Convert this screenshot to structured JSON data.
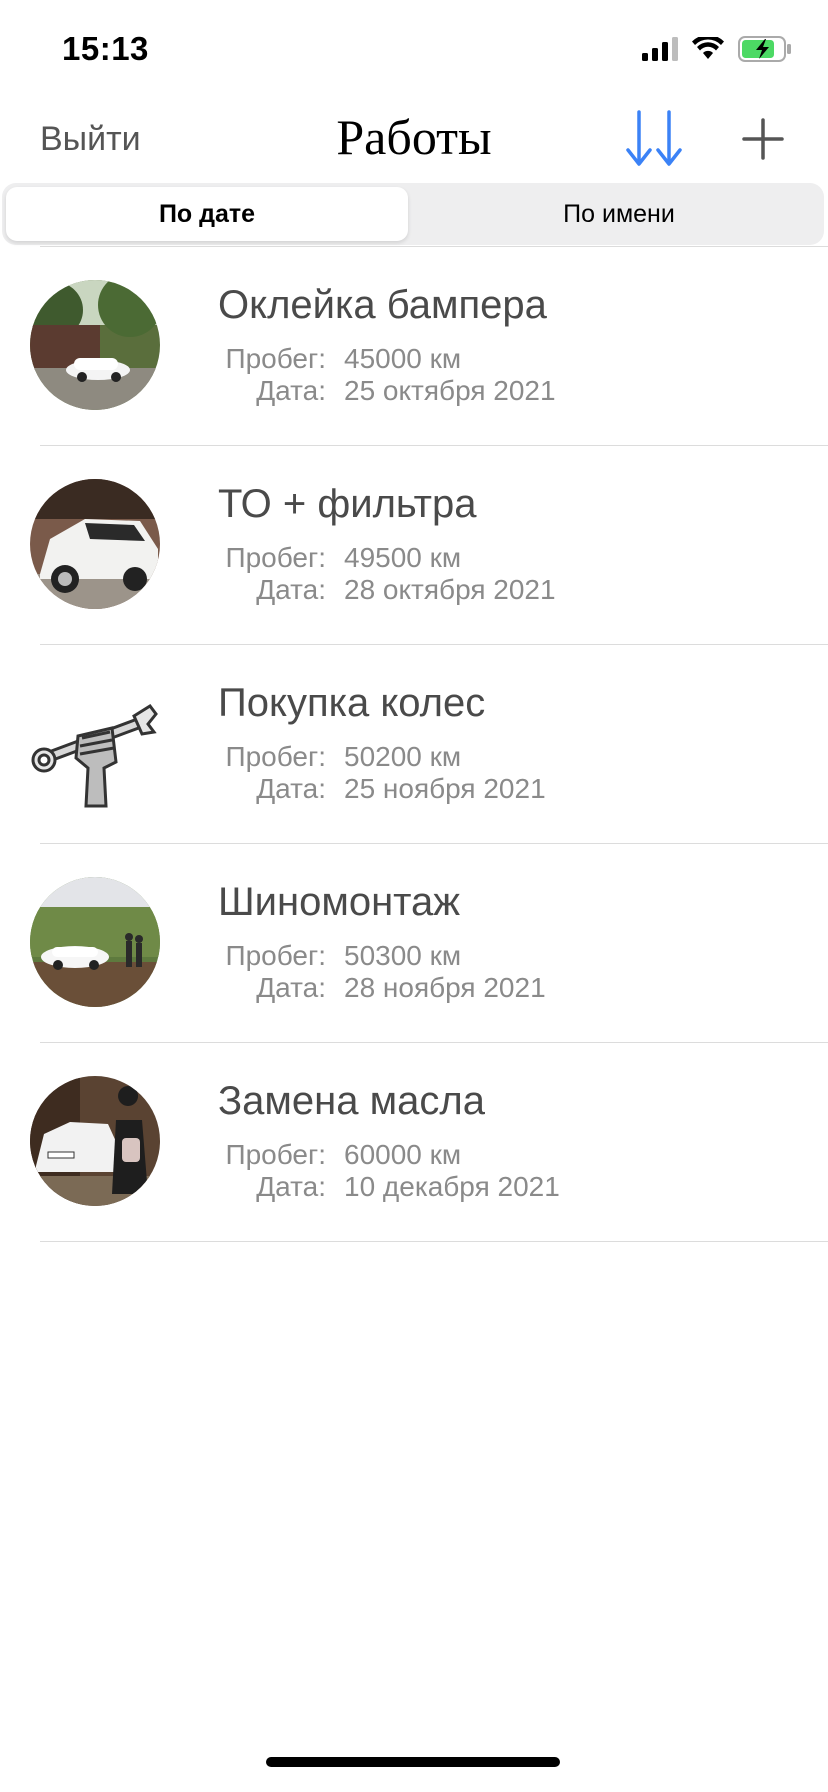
{
  "status_bar": {
    "time": "15:13",
    "icons": [
      "signal-icon",
      "wifi-icon",
      "battery-charging-icon"
    ]
  },
  "nav": {
    "logout_label": "Выйти",
    "title": "Работы",
    "sort_icon": "sort-arrows-icon",
    "add_icon": "plus-icon",
    "accent_color": "#3b82f6"
  },
  "segmented": {
    "selected": "По дате",
    "options": [
      "По дате",
      "По имени"
    ]
  },
  "jobs": {
    "mileage_label": "Пробег:",
    "date_label": "Дата:",
    "items": [
      {
        "title": "Оклейка бампера",
        "mileage": "45000 км",
        "date": "25 октября 2021",
        "image": "car-photo"
      },
      {
        "title": "ТО + фильтра",
        "mileage": "49500 км",
        "date": "28 октября 2021",
        "image": "car-photo"
      },
      {
        "title": "Покупка колес",
        "mileage": "50200 км",
        "date": "25 ноября 2021",
        "image": "wrench-fist-icon"
      },
      {
        "title": "Шиномонтаж",
        "mileage": "50300 км",
        "date": "28 ноября 2021",
        "image": "car-photo"
      },
      {
        "title": "Замена масла",
        "mileage": "60000 км",
        "date": "10 декабря 2021",
        "image": "car-photo"
      }
    ]
  }
}
